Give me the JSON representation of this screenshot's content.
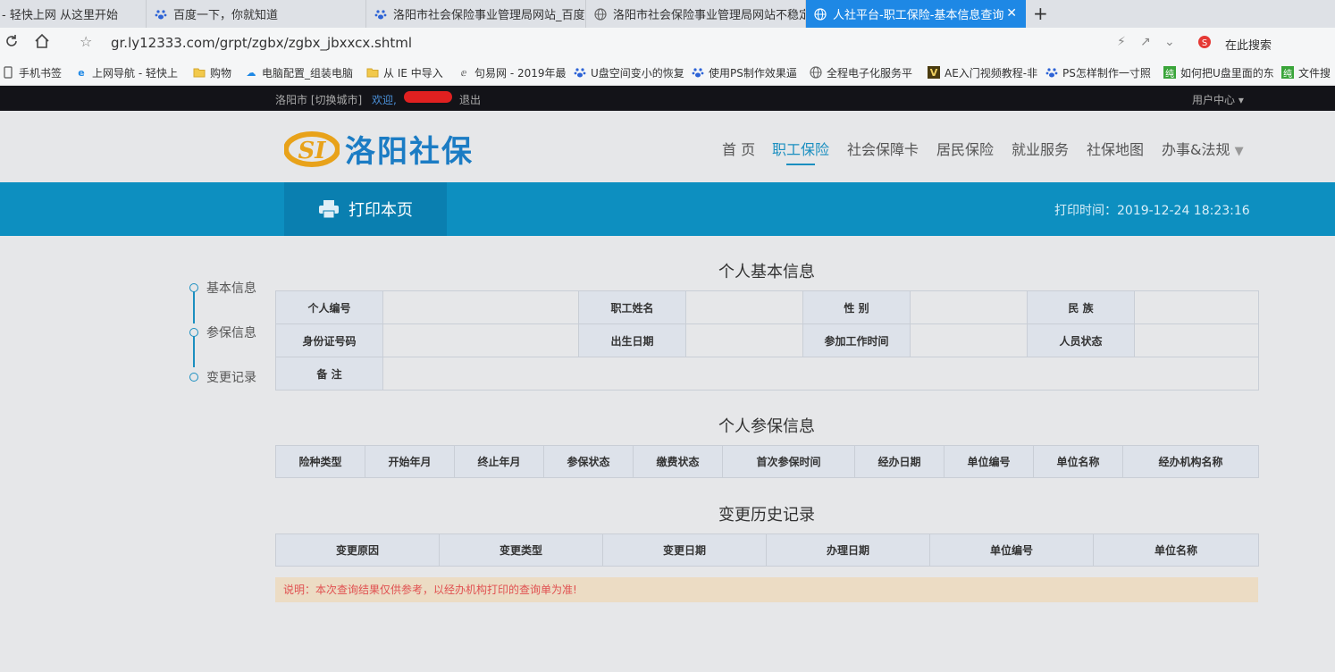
{
  "browser": {
    "tabs": [
      {
        "title": "- 轻快上网 从这里开始",
        "icon": "none"
      },
      {
        "title": "百度一下，你就知道",
        "icon": "baidu-paw-icon"
      },
      {
        "title": "洛阳市社会保险事业管理局网站_百度",
        "icon": "baidu-paw-icon"
      },
      {
        "title": "洛阳市社会保险事业管理局网站不稳定",
        "icon": "globe-icon"
      },
      {
        "title": "人社平台-职工保险-基本信息查询",
        "icon": "globe-icon"
      }
    ],
    "url": "gr.ly12333.com/grpt/zgbx/zgbx_jbxxcx.shtml",
    "search_label": "在此搜索",
    "bookmarks": [
      {
        "label": "手机书签",
        "icon": "phone-icon"
      },
      {
        "label": "上网导航 - 轻快上",
        "icon": "ie-icon"
      },
      {
        "label": "购物",
        "icon": "folder-icon"
      },
      {
        "label": "电脑配置_组装电脑",
        "icon": "zol-icon"
      },
      {
        "label": "从 IE 中导入",
        "icon": "folder-icon"
      },
      {
        "label": "句易网 - 2019年最",
        "icon": "link-icon"
      },
      {
        "label": "U盘空间变小的恢复",
        "icon": "baidu-paw-icon"
      },
      {
        "label": "使用PS制作效果逼",
        "icon": "baidu-paw-icon"
      },
      {
        "label": "全程电子化服务平",
        "icon": "globe-icon"
      },
      {
        "label": "AE入门视频教程-非",
        "icon": "ae-icon"
      },
      {
        "label": "PS怎样制作一寸照",
        "icon": "baidu-paw-icon"
      },
      {
        "label": "如何把U盘里面的东",
        "icon": "chun-icon"
      },
      {
        "label": "文件搜",
        "icon": "chun-icon"
      }
    ]
  },
  "site": {
    "city": "洛阳市 [切换城市]",
    "welcome": "欢迎,",
    "logout": "退出",
    "user_center": "用户中心",
    "logo_text": "洛阳社保",
    "nav": [
      "首 页",
      "职工保险",
      "社会保障卡",
      "居民保险",
      "就业服务",
      "社保地图",
      "办事&法规"
    ],
    "print_label": "打印本页",
    "print_time": "打印时间：2019-12-24 18:23:16",
    "side_nav": [
      "基本信息",
      "参保信息",
      "变更记录"
    ],
    "basic_title": "个人基本信息",
    "basic_rows": [
      [
        "个人编号",
        "",
        "职工姓名",
        "",
        "性  别",
        "",
        "民  族",
        ""
      ],
      [
        "身份证号码",
        "",
        "出生日期",
        "",
        "参加工作时间",
        "",
        "人员状态",
        ""
      ],
      [
        "备  注",
        ""
      ]
    ],
    "insure_title": "个人参保信息",
    "insure_headers": [
      "险种类型",
      "开始年月",
      "终止年月",
      "参保状态",
      "缴费状态",
      "首次参保时间",
      "经办日期",
      "单位编号",
      "单位名称",
      "经办机构名称"
    ],
    "history_title": "变更历史记录",
    "history_headers": [
      "变更原因",
      "变更类型",
      "变更日期",
      "办理日期",
      "单位编号",
      "单位名称"
    ],
    "note": "说明：本次查询结果仅供参考，以经办机构打印的查询单为准!"
  },
  "colors": {
    "accent": "#0d8fc0",
    "active_tab": "#1e88e5",
    "note_text": "#e05050"
  }
}
